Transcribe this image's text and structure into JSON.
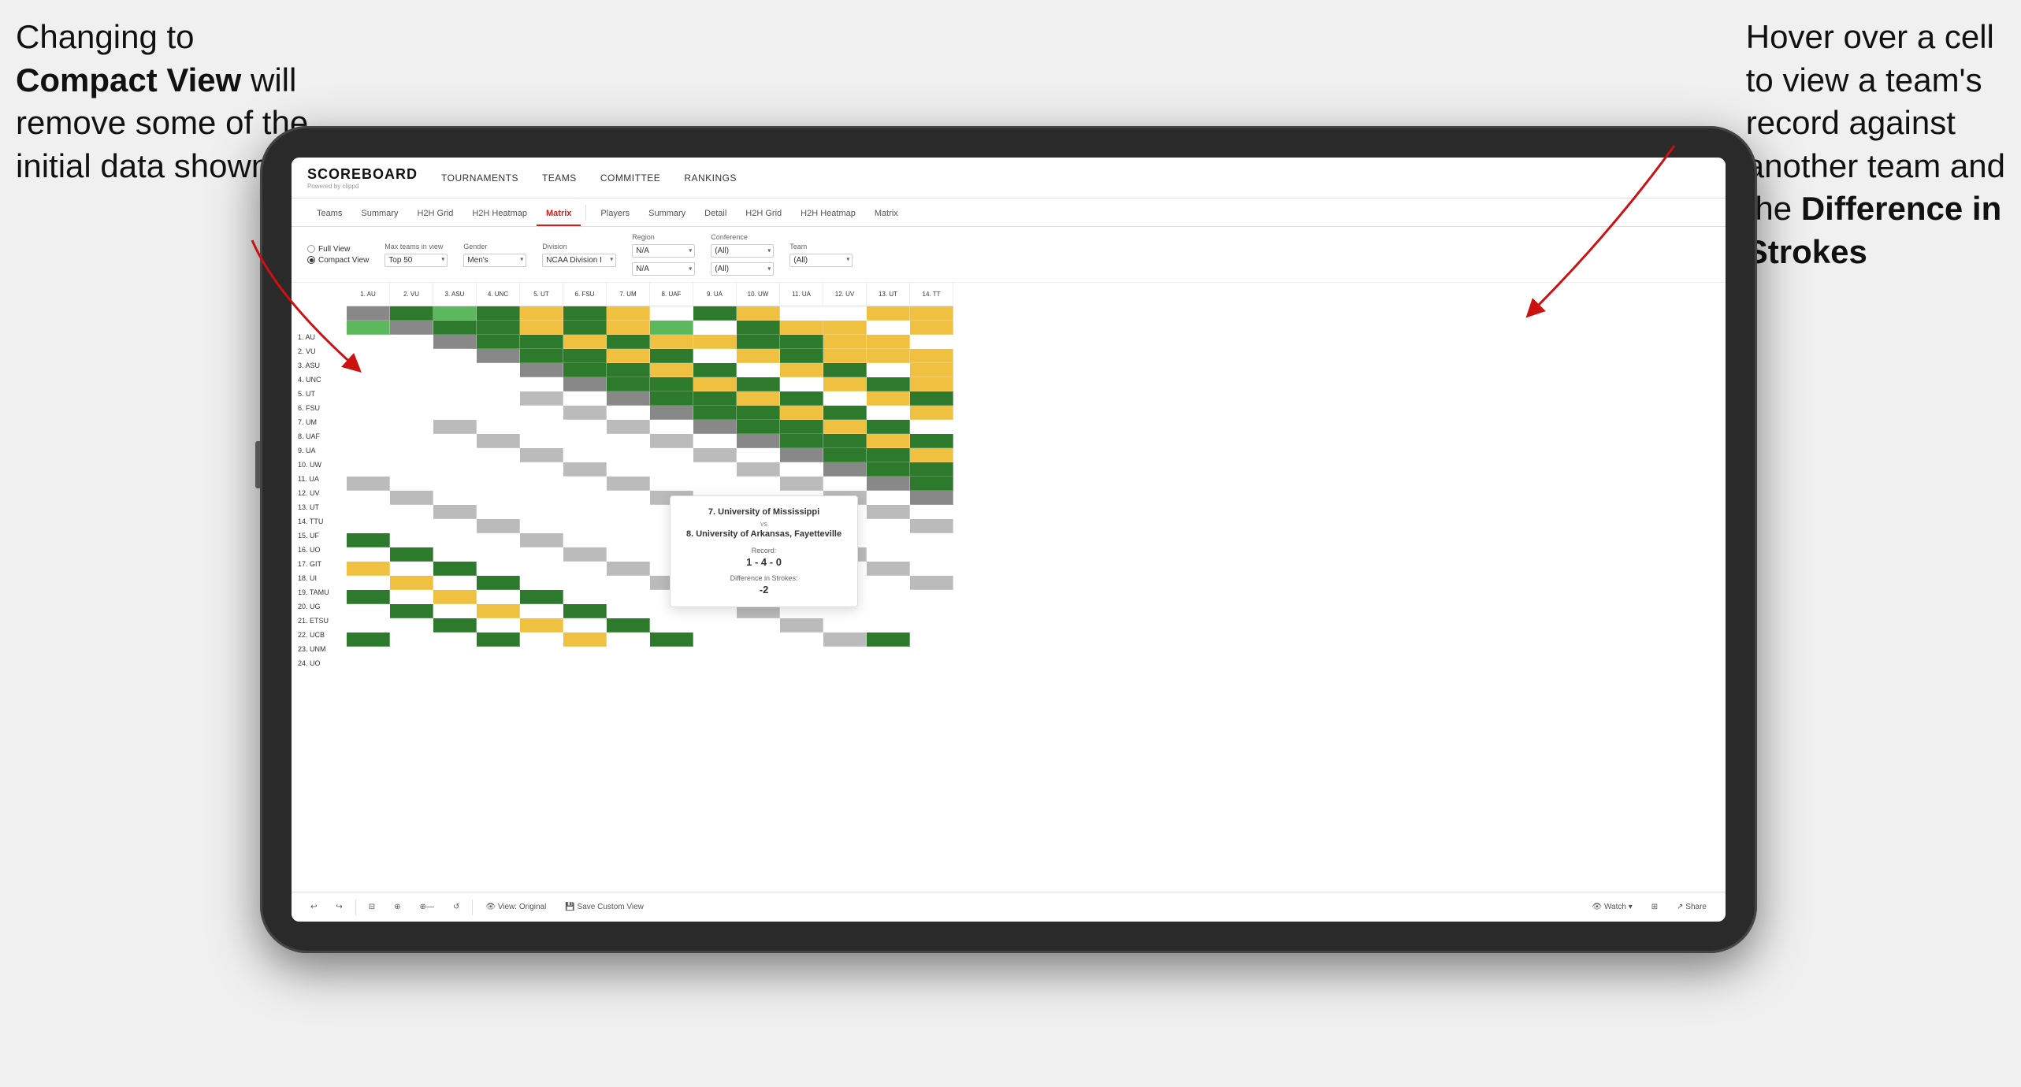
{
  "annotations": {
    "left": {
      "line1": "Changing to",
      "line2bold": "Compact View",
      "line2rest": " will",
      "line3": "remove some of the",
      "line4": "initial data shown"
    },
    "right": {
      "line1": "Hover over a cell",
      "line2": "to view a team's",
      "line3": "record against",
      "line4": "another team and",
      "line5": "the ",
      "line5bold": "Difference in",
      "line6bold": "Strokes"
    }
  },
  "navbar": {
    "logo": "SCOREBOARD",
    "logo_sub": "Powered by clippd",
    "links": [
      "TOURNAMENTS",
      "TEAMS",
      "COMMITTEE",
      "RANKINGS"
    ]
  },
  "subtabs": {
    "groups": [
      {
        "label": "Teams",
        "active": false
      },
      {
        "label": "Summary",
        "active": false
      },
      {
        "label": "H2H Grid",
        "active": false
      },
      {
        "label": "H2H Heatmap",
        "active": false
      },
      {
        "label": "Matrix",
        "active": true
      }
    ],
    "groups2": [
      {
        "label": "Players",
        "active": false
      },
      {
        "label": "Summary",
        "active": false
      },
      {
        "label": "Detail",
        "active": false
      },
      {
        "label": "H2H Grid",
        "active": false
      },
      {
        "label": "H2H Heatmap",
        "active": false
      },
      {
        "label": "Matrix",
        "active": false
      }
    ]
  },
  "filters": {
    "view_options": [
      "Full View",
      "Compact View"
    ],
    "selected_view": "Compact View",
    "max_teams": {
      "label": "Max teams in view",
      "value": "Top 50"
    },
    "gender": {
      "label": "Gender",
      "value": "Men's"
    },
    "division": {
      "label": "Division",
      "value": "NCAA Division I"
    },
    "region": {
      "label": "Region",
      "value": "N/A",
      "value2": "N/A"
    },
    "conference": {
      "label": "Conference",
      "value": "(All)",
      "value2": "(All)"
    },
    "team": {
      "label": "Team",
      "value": "(All)"
    }
  },
  "col_headers": [
    "1. AU",
    "2. VU",
    "3. ASU",
    "4. UNC",
    "5. UT",
    "6. FSU",
    "7. UM",
    "8. UAF",
    "9. UA",
    "10. UW",
    "11. UA",
    "12. UV",
    "13. UT",
    "14. TT"
  ],
  "row_labels": [
    "1. AU",
    "2. VU",
    "3. ASU",
    "4. UNC",
    "5. UT",
    "6. FSU",
    "7. UM",
    "8. UAF",
    "9. UA",
    "10. UW",
    "11. UA",
    "12. UV",
    "13. UT",
    "14. TTU",
    "15. UF",
    "16. UO",
    "17. GIT",
    "18. UI",
    "19. TAMU",
    "20. UG",
    "21. ETSU",
    "22. UCB",
    "23. UNM",
    "24. UO"
  ],
  "tooltip": {
    "team1": "7. University of Mississippi",
    "vs": "vs",
    "team2": "8. University of Arkansas, Fayetteville",
    "record_label": "Record:",
    "record": "1 - 4 - 0",
    "diff_label": "Difference in Strokes:",
    "diff": "-2"
  },
  "toolbar": {
    "buttons": [
      "↩",
      "↪",
      "⊟",
      "⊕",
      "⊕—",
      "↺",
      "View: Original",
      "Save Custom View",
      "Watch ▾",
      "⊞",
      "Share"
    ]
  },
  "matrix_data": {
    "colors": {
      "green_dark": "#2d7a2d",
      "green_light": "#5cb85c",
      "yellow": "#f0c040",
      "gray": "#bbb",
      "white": "#fff",
      "diagonal": "#888"
    }
  }
}
